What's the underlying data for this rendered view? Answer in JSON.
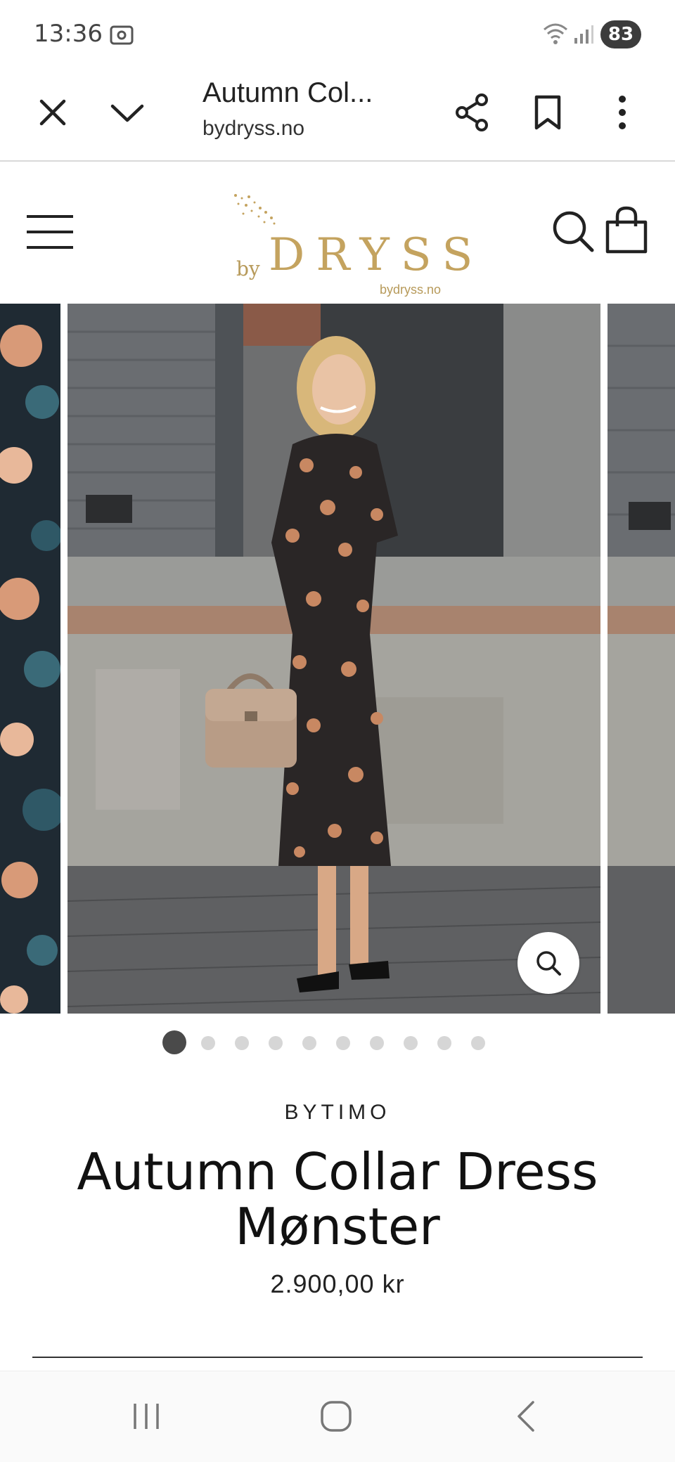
{
  "status_bar": {
    "time": "13:36",
    "battery": "83"
  },
  "browser": {
    "title": "Autumn Col...",
    "url": "bydryss.no"
  },
  "site": {
    "logo_prefix": "by",
    "logo_name": "DRYSS",
    "logo_url": "bydryss.no"
  },
  "gallery": {
    "total_images": 10,
    "active_index": 0
  },
  "product": {
    "brand": "BYTIMO",
    "title": "Autumn Collar Dress Mønster",
    "price": "2.900,00 kr"
  },
  "colors": {
    "accent_gold": "#c4a35f",
    "text": "#111111"
  }
}
